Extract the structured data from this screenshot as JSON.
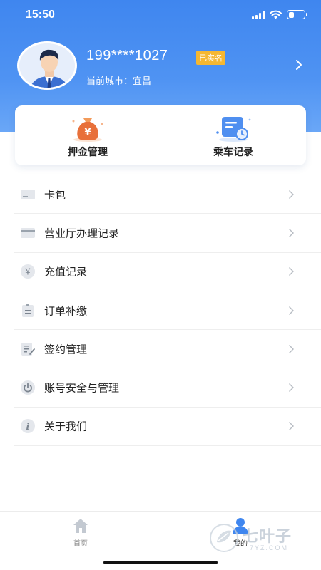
{
  "status_bar": {
    "time": "15:50",
    "battery_level": 0.35
  },
  "profile": {
    "phone": "199****1027",
    "verified_badge": "已实名",
    "city_label": "当前城市：宜昌"
  },
  "quick_actions": [
    {
      "label": "押金管理",
      "icon": "money-bag-icon"
    },
    {
      "label": "乘车记录",
      "icon": "ride-record-icon"
    }
  ],
  "menu": [
    {
      "label": "卡包",
      "icon": "card-icon"
    },
    {
      "label": "营业厅办理记录",
      "icon": "counter-icon"
    },
    {
      "label": "充值记录",
      "icon": "yuan-icon"
    },
    {
      "label": "订单补缴",
      "icon": "order-icon"
    },
    {
      "label": "签约管理",
      "icon": "contract-icon"
    },
    {
      "label": "账号安全与管理",
      "icon": "power-icon"
    },
    {
      "label": "关于我们",
      "icon": "info-icon"
    }
  ],
  "tabbar": [
    {
      "label": "首页",
      "icon": "home-icon",
      "active": false
    },
    {
      "label": "我的",
      "icon": "user-icon",
      "active": true
    }
  ],
  "watermark": {
    "text": "七叶子",
    "sub": "7YZ.COM"
  },
  "colors": {
    "brand_blue": "#3f86ef",
    "badge_orange": "#f5b731",
    "icon_grey": "#9aa3ad"
  }
}
